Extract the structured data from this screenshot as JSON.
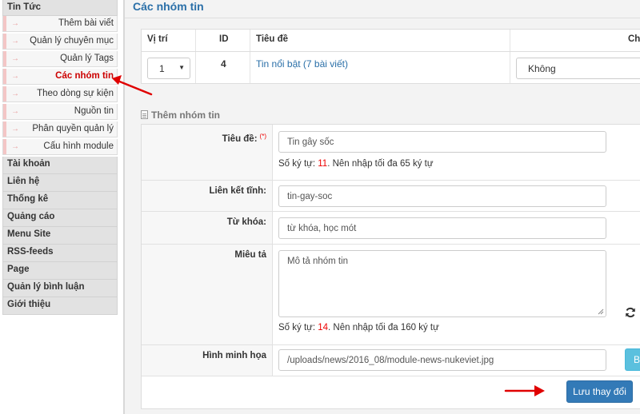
{
  "sidebar": {
    "news_heading": "Tin Tức",
    "news_items": [
      {
        "label": "Thêm bài viết"
      },
      {
        "label": "Quản lý chuyên mục"
      },
      {
        "label": "Quản lý Tags"
      },
      {
        "label": "Các nhóm tin",
        "active": true
      },
      {
        "label": "Theo dòng sự kiện"
      },
      {
        "label": "Nguồn tin"
      },
      {
        "label": "Phân quyền quản lý"
      },
      {
        "label": "Cấu hình module"
      }
    ],
    "arrow_glyph": "→",
    "modules": [
      "Tài khoản",
      "Liên hệ",
      "Thống kê",
      "Quảng cáo",
      "Menu Site",
      "RSS-feeds",
      "Page",
      "Quản lý bình luận",
      "Giới thiệu"
    ]
  },
  "page_title": "Các nhóm tin",
  "table": {
    "headers": [
      "Vị trí",
      "ID",
      "Tiêu đề",
      "Ch"
    ],
    "row": {
      "position": "1",
      "id": "4",
      "title": "Tin nổi bật (7 bài viết)",
      "select_value": "Không"
    }
  },
  "form": {
    "legend": "Thêm nhóm tin",
    "title_label": "Tiêu đề:",
    "required_mark": "(*)",
    "title_value": "Tin gây sốc",
    "title_hint_prefix": "Số ký tự: ",
    "title_hint_count": "11",
    "title_hint_suffix": ". Nên nhập tối đa 65 ký tự",
    "alias_label": "Liên kết tĩnh:",
    "alias_value": "tin-gay-soc",
    "keywords_label": "Từ khóa:",
    "keywords_value": "từ khóa, học mót",
    "description_label": "Miêu tả",
    "description_value": "Mô tả nhóm tin",
    "description_hint_prefix": "Số ký tự: ",
    "description_hint_count": "14",
    "description_hint_suffix": ". Nên nhập tối đa 160 ký tự",
    "image_label": "Hình minh họa",
    "image_value": "/uploads/news/2016_08/module-news-nukeviet.jpg",
    "browse_label": "Browse",
    "save_label": "Lưu thay đổi"
  },
  "colors": {
    "accent_blue": "#2a6fa8",
    "button_primary": "#337ab7",
    "button_info": "#5bc0de",
    "annotation_arrow": "#e00000",
    "active_menu": "#cc0000"
  }
}
